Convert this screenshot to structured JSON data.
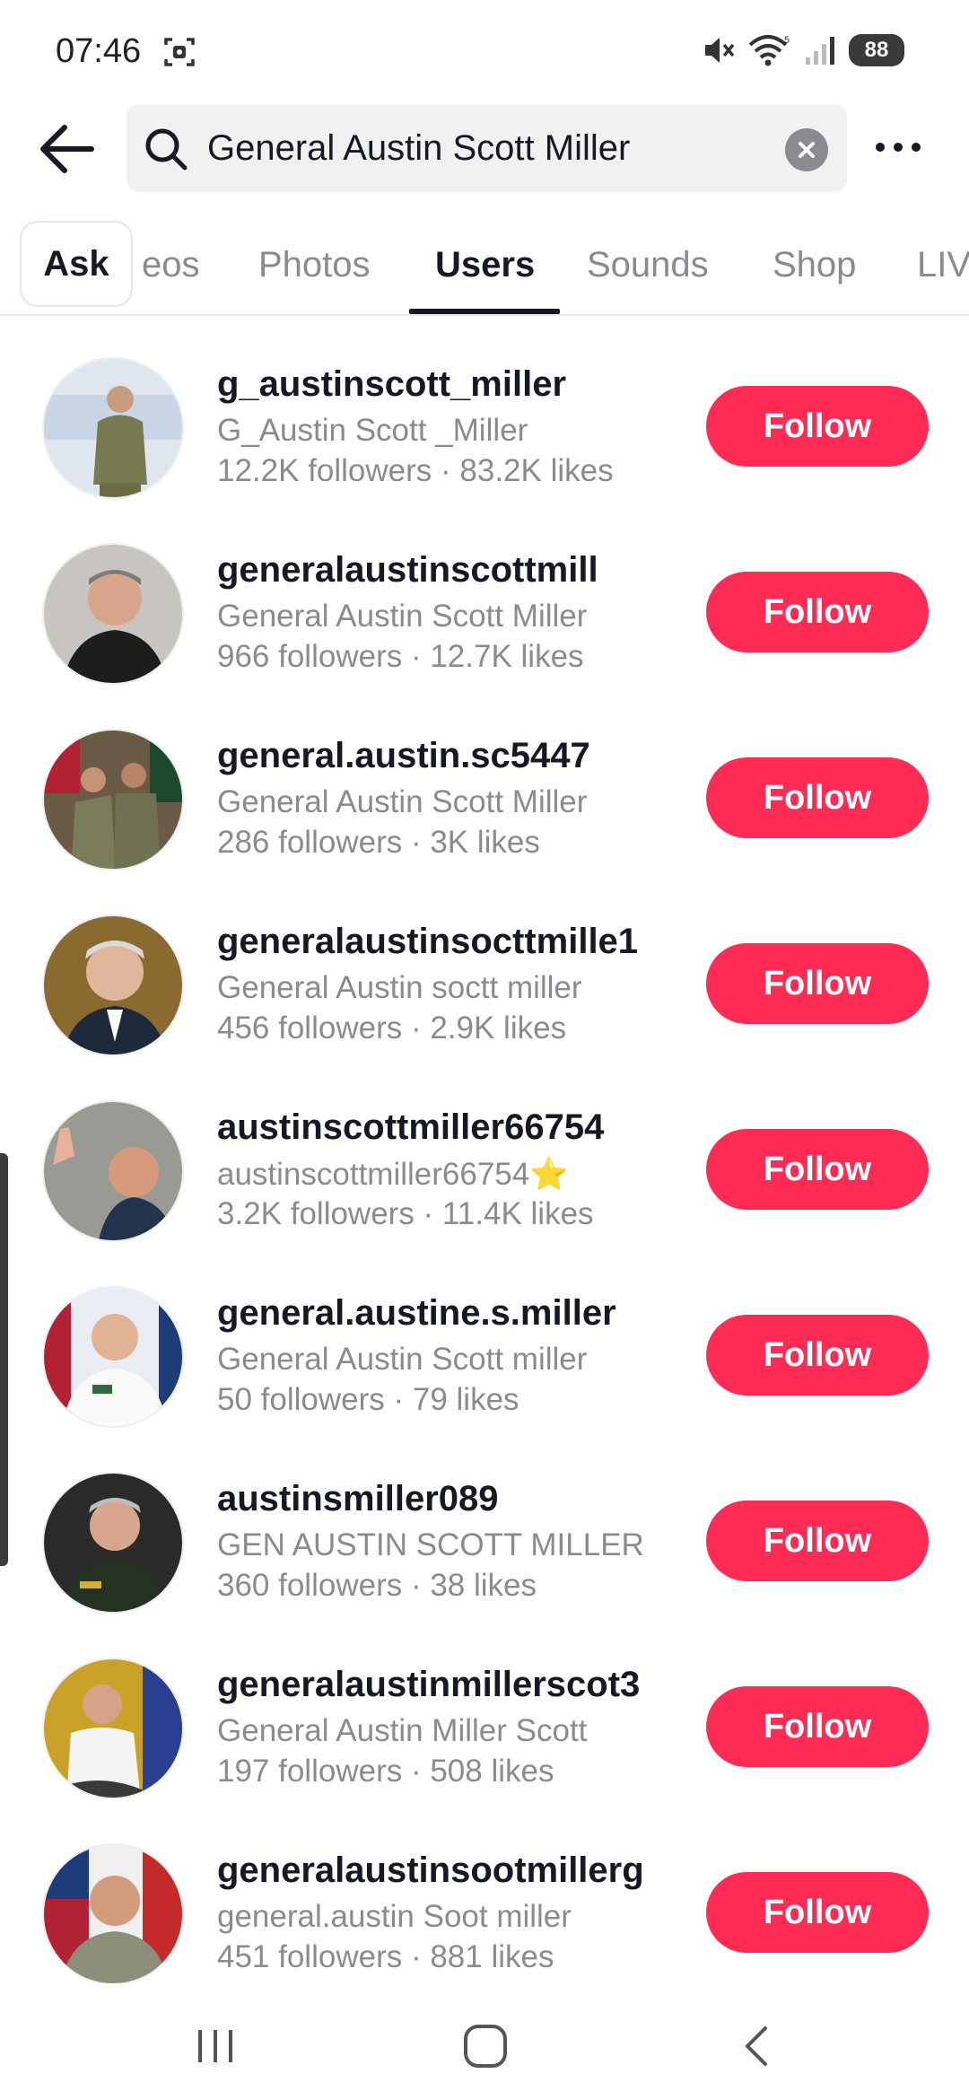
{
  "status_bar": {
    "time": "07:46",
    "battery": "88"
  },
  "search": {
    "query": "General Austin Scott Miller"
  },
  "tabs": [
    {
      "label": "Ask"
    },
    {
      "label": "eos"
    },
    {
      "label": "Photos"
    },
    {
      "label": "Users"
    },
    {
      "label": "Sounds"
    },
    {
      "label": "Shop"
    },
    {
      "label": "LIV"
    }
  ],
  "active_tab": "Users",
  "follow_label": "Follow",
  "accent_color": "#fe2c55",
  "users": [
    {
      "username": "g_austinscott_miller",
      "nickname": "G_Austin Scott _Miller",
      "stats": "12.2K followers · 83.2K likes"
    },
    {
      "username": "generalaustinscottmill",
      "nickname": "General Austin Scott Miller",
      "stats": "966 followers · 12.7K likes"
    },
    {
      "username": "general.austin.sc5447",
      "nickname": "General Austin Scott Miller",
      "stats": "286 followers · 3K likes"
    },
    {
      "username": "generalaustinsocttmille1",
      "nickname": "General Austin soctt miller",
      "stats": "456 followers · 2.9K likes"
    },
    {
      "username": "austinscottmiller66754",
      "nickname": "austinscottmiller66754⭐",
      "stats": "3.2K followers · 11.4K likes"
    },
    {
      "username": "general.austine.s.miller",
      "nickname": "General Austin Scott miller",
      "stats": "50 followers · 79 likes"
    },
    {
      "username": "austinsmiller089",
      "nickname": "GEN AUSTIN SCOTT MILLER",
      "stats": "360 followers · 38 likes"
    },
    {
      "username": "generalaustinmillerscot3",
      "nickname": "General Austin Miller Scott",
      "stats": "197 followers · 508 likes"
    },
    {
      "username": "generalaustinsootmillerg",
      "nickname": "general.austin Soot miller",
      "stats": "451 followers · 881 likes"
    }
  ]
}
